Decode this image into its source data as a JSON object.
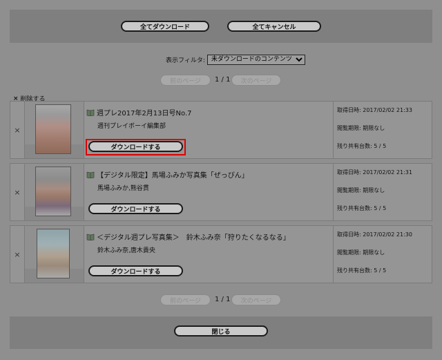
{
  "top_buttons": {
    "download_all": "全てダウンロード",
    "cancel_all": "全てキャンセル"
  },
  "filter": {
    "label": "表示フィルタ:",
    "selected": "未ダウンロードのコンテンツ"
  },
  "pager": {
    "prev": "前のページ",
    "next": "次のページ",
    "counter": "1 / 1"
  },
  "delete_all": "削除する",
  "delete_icon": "×",
  "items": [
    {
      "title": "週プレ2017年2月13日号No.7",
      "author": "週刊プレイボーイ編集部",
      "download_label": "ダウンロードする",
      "acquired": "取得日時: 2017/02/02 21:33",
      "expiry": "閲覧期限: 期限なし",
      "devices": "残り共有台数: 5 / 5"
    },
    {
      "title": "【デジタル限定】馬場ふみか写真集「ぜっぴん」",
      "author": "馬場ふみか,熊谷貫",
      "download_label": "ダウンロードする",
      "acquired": "取得日時: 2017/02/02 21:31",
      "expiry": "閲覧期限: 期限なし",
      "devices": "残り共有台数: 5 / 5"
    },
    {
      "title": "＜デジタル週プレ写真集＞　鈴木ふみ奈「狩りたくなるなる」",
      "author": "鈴木ふみ奈,唐木貴央",
      "download_label": "ダウンロードする",
      "acquired": "取得日時: 2017/02/02 21:30",
      "expiry": "閲覧期限: 期限なし",
      "devices": "残り共有台数: 5 / 5"
    }
  ],
  "close_button": "閉じる",
  "icons": {
    "delete": "close-icon",
    "book": "book-icon"
  },
  "colors": {
    "highlight": "#e00000",
    "overlay": "#8f8f8f"
  }
}
